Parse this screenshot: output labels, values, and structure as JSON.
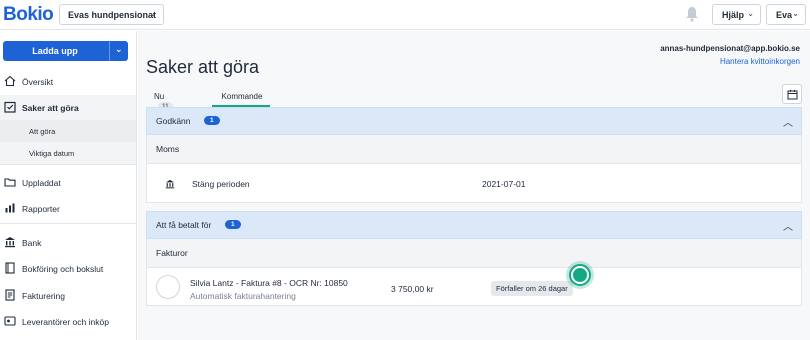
{
  "header": {
    "logo": "Bokio",
    "company": "Evas hundpensionat",
    "help_label": "Hjälp",
    "user_label": "Eva"
  },
  "sidebar": {
    "upload_label": "Ladda upp",
    "items": [
      {
        "label": "Översikt",
        "icon": "home-icon"
      },
      {
        "label": "Saker att göra",
        "icon": "checklist-icon"
      },
      {
        "label": "Uppladdat",
        "icon": "folder-icon"
      },
      {
        "label": "Rapporter",
        "icon": "chart-icon"
      },
      {
        "label": "Bank",
        "icon": "bank-icon"
      },
      {
        "label": "Bokföring och bokslut",
        "icon": "book-icon"
      },
      {
        "label": "Fakturering",
        "icon": "invoice-icon"
      },
      {
        "label": "Leverantörer och inköp",
        "icon": "supplier-icon"
      }
    ],
    "subitems": [
      {
        "label": "Att göra"
      },
      {
        "label": "Viktiga datum"
      }
    ]
  },
  "main": {
    "title": "Saker att göra",
    "email": "annas-hundpensionat@app.bokio.se",
    "inbox_link": "Hantera kvittoinkorgen",
    "tabs": [
      {
        "label": "Nu",
        "count": "11"
      },
      {
        "label": "Kommande"
      }
    ],
    "sections": [
      {
        "title": "Godkänn",
        "badge": "1",
        "group": "Moms",
        "row": {
          "label": "Stäng perioden",
          "date": "2021-07-01"
        }
      },
      {
        "title": "Att få betalt för",
        "badge": "1",
        "group": "Fakturor",
        "row": {
          "label": "Silvia Lantz - Faktura #8 - OCR Nr: 10850",
          "sublabel": "Automatisk fakturahantering",
          "amount": "3 750,00 kr",
          "status": "Förfaller om 26 dagar"
        }
      }
    ]
  },
  "colors": {
    "brand": "#1e63d6",
    "accent": "#15a884",
    "section_header": "#dbe8f8"
  }
}
